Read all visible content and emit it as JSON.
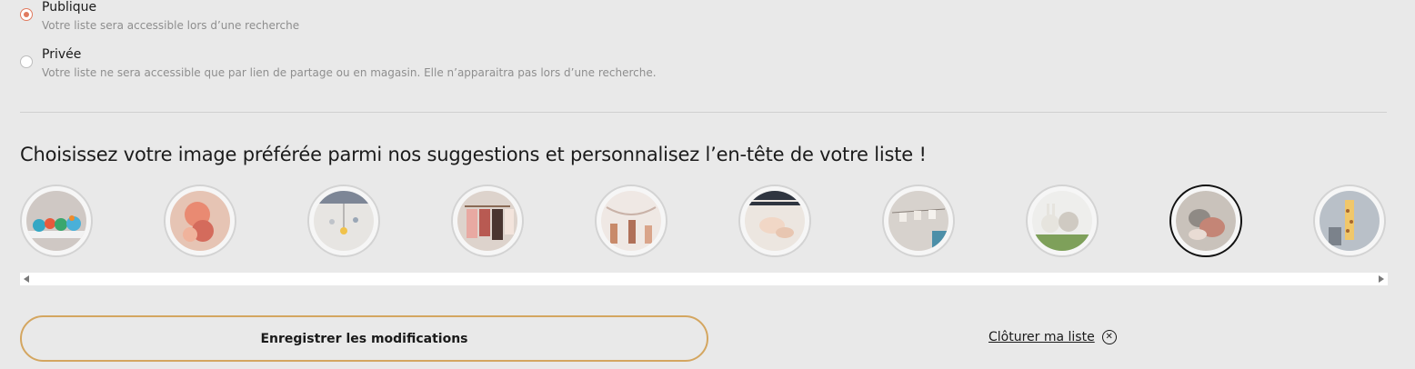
{
  "visibility": {
    "options": [
      {
        "title": "Publique",
        "description": "Votre liste sera accessible lors d’une recherche",
        "checked": true
      },
      {
        "title": "Privée",
        "description": "Votre liste ne sera accessible que par lien de partage ou en magasin. Elle n’apparaitra pas lors d’une recherche.",
        "checked": false
      }
    ]
  },
  "header_images": {
    "heading": "Choisissez votre image préférée parmi nos suggestions et personnalisez l’en-tête de votre liste !",
    "images": [
      {
        "name": "toy-animals-shelf-image",
        "selected": false
      },
      {
        "name": "pink-plush-toy-image",
        "selected": false
      },
      {
        "name": "crib-mobile-image",
        "selected": false
      },
      {
        "name": "baby-clothes-rack-image",
        "selected": false
      },
      {
        "name": "nursery-garland-image",
        "selected": false
      },
      {
        "name": "baby-feet-blanket-image",
        "selected": false
      },
      {
        "name": "wall-hanging-clothes-image",
        "selected": false
      },
      {
        "name": "bunny-plush-toys-image",
        "selected": false
      },
      {
        "name": "baby-shoes-image",
        "selected": true
      },
      {
        "name": "giraffe-toy-image",
        "selected": false
      }
    ]
  },
  "actions": {
    "save_label": "Enregistrer les modifications",
    "close_label": "Clôturer ma liste",
    "close_icon": "close-circle-icon"
  },
  "colors": {
    "accent_border": "#d4a660",
    "radio_checked": "#e07a5f"
  }
}
